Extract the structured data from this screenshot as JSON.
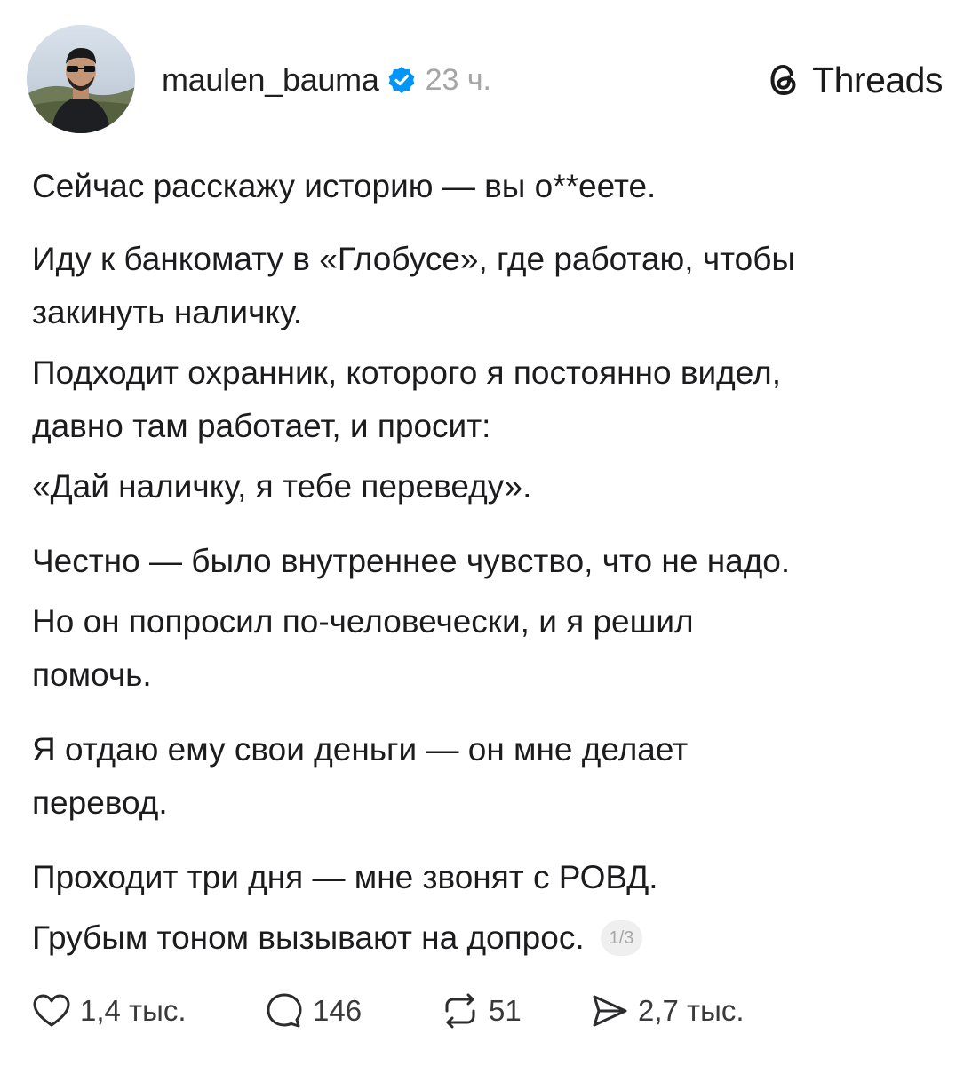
{
  "post": {
    "author": {
      "username": "maulen_bauma",
      "verified": true,
      "time_ago": "23 ч."
    },
    "brand": {
      "label": "Threads"
    },
    "paragraphs": [
      [
        "Сейчас расскажу историю — вы о**еете."
      ],
      [
        "Иду к банкомату в «Глобусе», где работаю, чтобы",
        "закинуть наличку."
      ],
      [
        "Подходит охранник, которого я постоянно видел,",
        "давно там работает, и просит:"
      ],
      [
        "«Дай наличку, я тебе переведу»."
      ],
      [
        "Честно — было внутреннее чувство, что не надо."
      ],
      [
        "Но он попросил по-человечески, и я решил",
        "помочь."
      ],
      [
        "Я отдаю ему свои деньги — он мне делает",
        "перевод."
      ],
      [
        "Проходит три дня — мне звонят с РОВД."
      ],
      [
        "Грубым тоном вызывают на допрос."
      ]
    ],
    "page_indicator": "1/3",
    "stats": {
      "likes": "1,4 тыс.",
      "replies": "146",
      "reposts": "51",
      "shares": "2,7 тыс."
    }
  },
  "colors": {
    "verified_blue": "#0095f6",
    "text": "#1c1c1e",
    "muted": "#a5a5a5"
  },
  "icons": {
    "like": "heart-icon",
    "reply": "comment-bubble-icon",
    "repost": "repost-arrows-icon",
    "share": "send-icon",
    "brand": "threads-logo-icon",
    "badge": "verified-check-icon"
  }
}
